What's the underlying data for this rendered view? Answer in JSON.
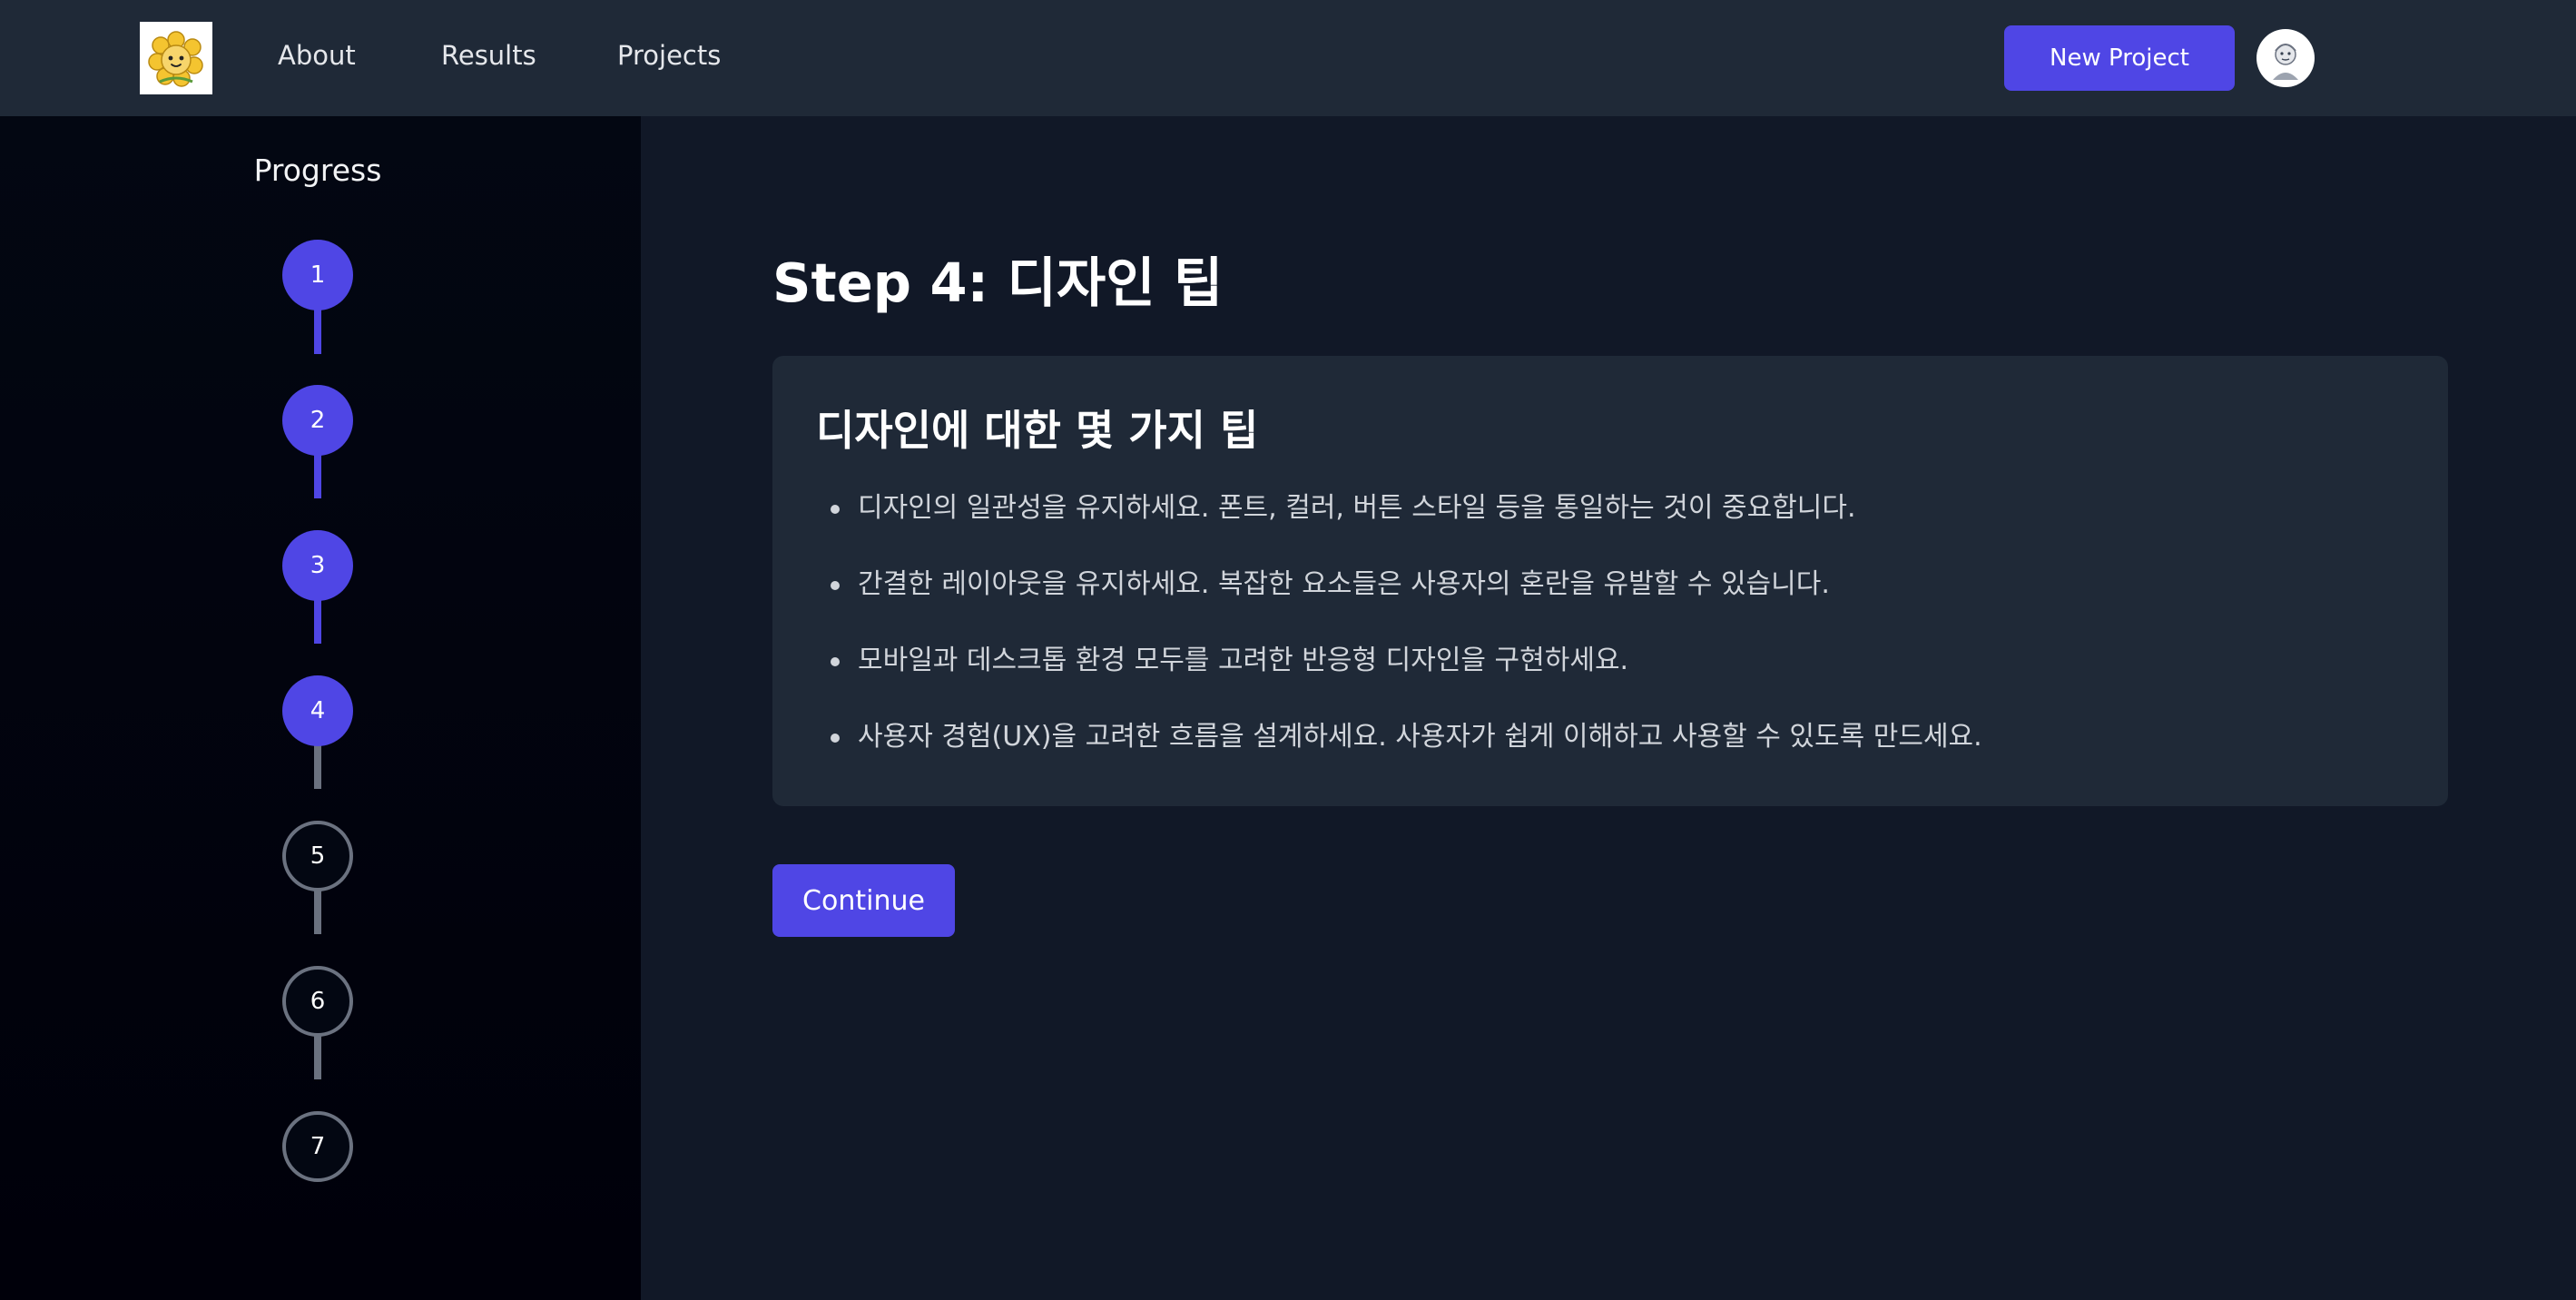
{
  "navbar": {
    "logo_icon": "flower-logo-icon",
    "links": [
      {
        "label": "About"
      },
      {
        "label": "Results"
      },
      {
        "label": "Projects"
      }
    ],
    "new_project_label": "New Project",
    "avatar_icon": "user-avatar-icon",
    "accent_color": "#4f46e5"
  },
  "sidebar": {
    "title": "Progress",
    "current_step": 4,
    "total_steps": 7,
    "steps": [
      {
        "label": "1",
        "status": "completed"
      },
      {
        "label": "2",
        "status": "completed"
      },
      {
        "label": "3",
        "status": "completed"
      },
      {
        "label": "4",
        "status": "current"
      },
      {
        "label": "5",
        "status": "upcoming"
      },
      {
        "label": "6",
        "status": "upcoming"
      },
      {
        "label": "7",
        "status": "upcoming"
      }
    ]
  },
  "main": {
    "heading": "Step 4: 디자인 팁",
    "card": {
      "title": "디자인에 대한 몇 가지 팁",
      "tips": [
        "디자인의 일관성을 유지하세요. 폰트, 컬러, 버튼 스타일 등을 통일하는 것이 중요합니다.",
        "간결한 레이아웃을 유지하세요. 복잡한 요소들은 사용자의 혼란을 유발할 수 있습니다.",
        "모바일과 데스크톱 환경 모두를 고려한 반응형 디자인을 구현하세요.",
        "사용자 경험(UX)을 고려한 흐름을 설계하세요. 사용자가 쉽게 이해하고 사용할 수 있도록 만드세요."
      ]
    },
    "continue_label": "Continue"
  }
}
